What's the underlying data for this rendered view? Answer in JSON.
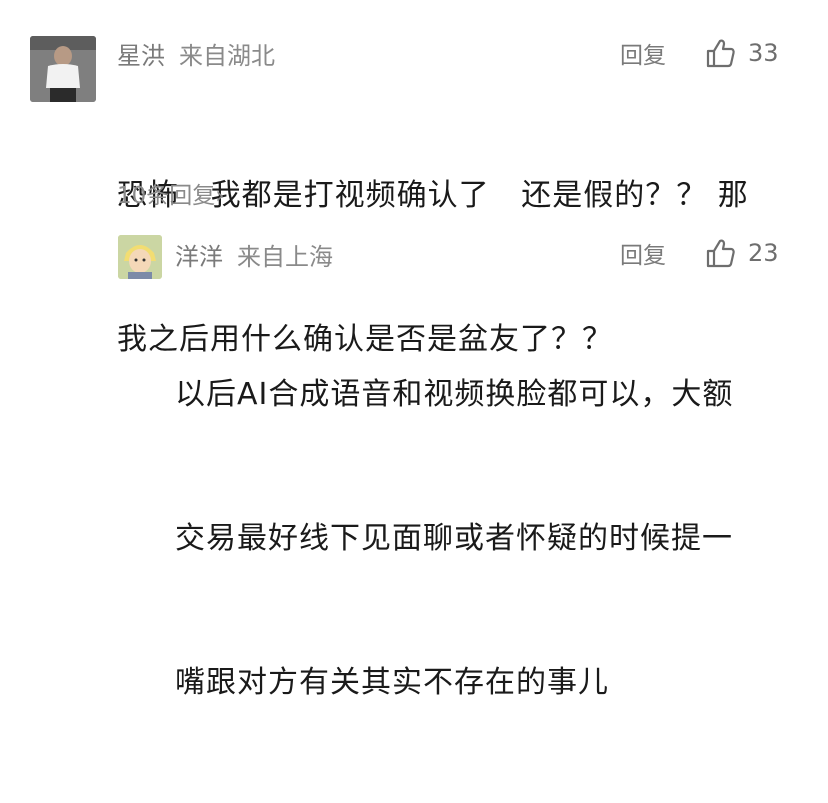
{
  "main_comment": {
    "username": "星洪",
    "location": "来自湖北",
    "reply_label": "回复",
    "like_count": "33",
    "text_line1": "恐怖   我都是打视频确认了   还是假的？？ 那",
    "text_line2": "我之后用什么确认是否是盆友了？？",
    "more_replies": "10条回复",
    "more_chevron": "›"
  },
  "reply_comment": {
    "username": "洋洋",
    "location": "来自上海",
    "reply_label": "回复",
    "like_count": "23",
    "text_line1": "以后AI合成语音和视频换脸都可以，大额",
    "text_line2": "交易最好线下见面聊或者怀疑的时候提一",
    "text_line3": "嘴跟对方有关其实不存在的事儿"
  },
  "icons": {
    "like": "thumbs-up-icon"
  },
  "colors": {
    "meta_text": "#8a8a8a",
    "body_text": "#1a1a1a",
    "background": "#ffffff"
  }
}
